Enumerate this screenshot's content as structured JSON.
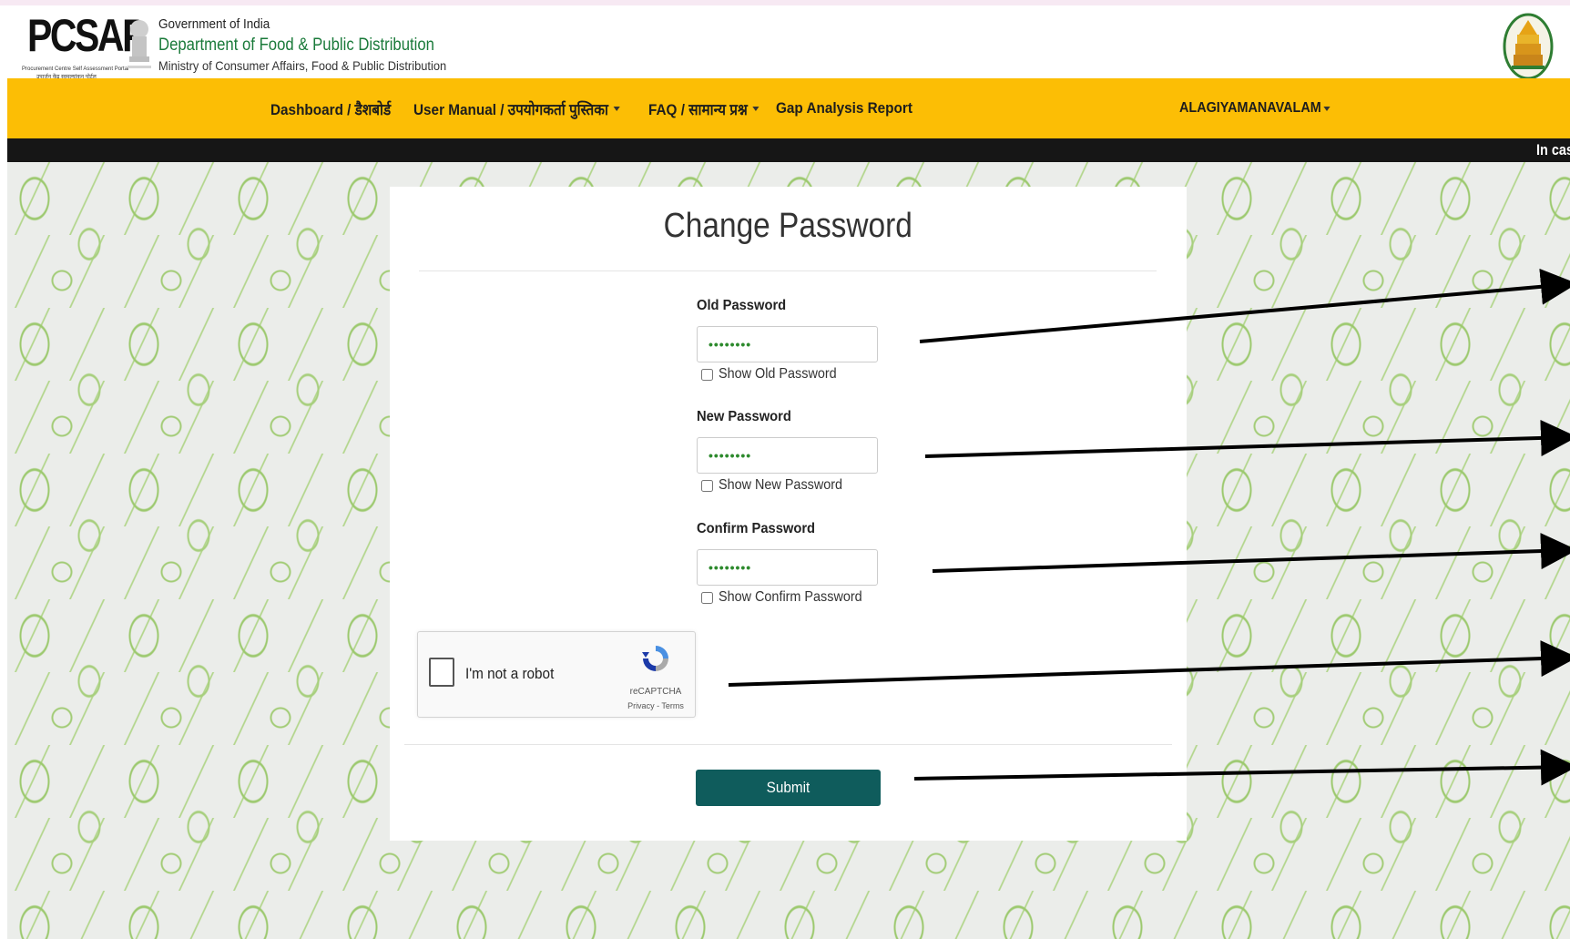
{
  "header": {
    "logo_text": "PCSAP",
    "logo_sub1": "Procurement Centre Self Assessment Portal",
    "logo_sub2": "उपार्जन केंद्र स्वमूल्यांकन पोर्टल",
    "gov_line": "Government of India",
    "dept_line": "Department of Food & Public Distribution",
    "ministry_line": "Ministry of  Consumer Affairs, Food & Public Distribution"
  },
  "nav": {
    "dashboard": "Dashboard / डैशबोर्ड",
    "user_manual": "User Manual / उपयोगकर्ता पुस्तिका",
    "faq": "FAQ / सामान्य प्रश्न",
    "gap_report": "Gap Analysis Report",
    "user_name": "ALAGIYAMANAVALAM"
  },
  "ticker": {
    "text": "In cas"
  },
  "form": {
    "title": "Change Password",
    "old_label": "Old Password",
    "old_value": "••••••••",
    "show_old": "Show Old Password",
    "new_label": "New Password",
    "new_value": "••••••••",
    "show_new": "Show New Password",
    "confirm_label": "Confirm Password",
    "confirm_value": "••••••••",
    "show_confirm": "Show Confirm Password",
    "submit_label": "Submit"
  },
  "recaptcha": {
    "label": "I'm not a robot",
    "brand": "reCAPTCHA",
    "privacy": "Privacy",
    "sep": " - ",
    "terms": "Terms"
  },
  "colors": {
    "nav_bg": "#fcbe05",
    "submit_bg": "#0f5c5c",
    "dept_green": "#1a7a3a",
    "ticker_bg": "#161616"
  },
  "icons": {
    "emblem": "ashoka-emblem-icon",
    "tn_emblem": "tamil-nadu-emblem-icon",
    "recaptcha": "recaptcha-logo-icon"
  }
}
